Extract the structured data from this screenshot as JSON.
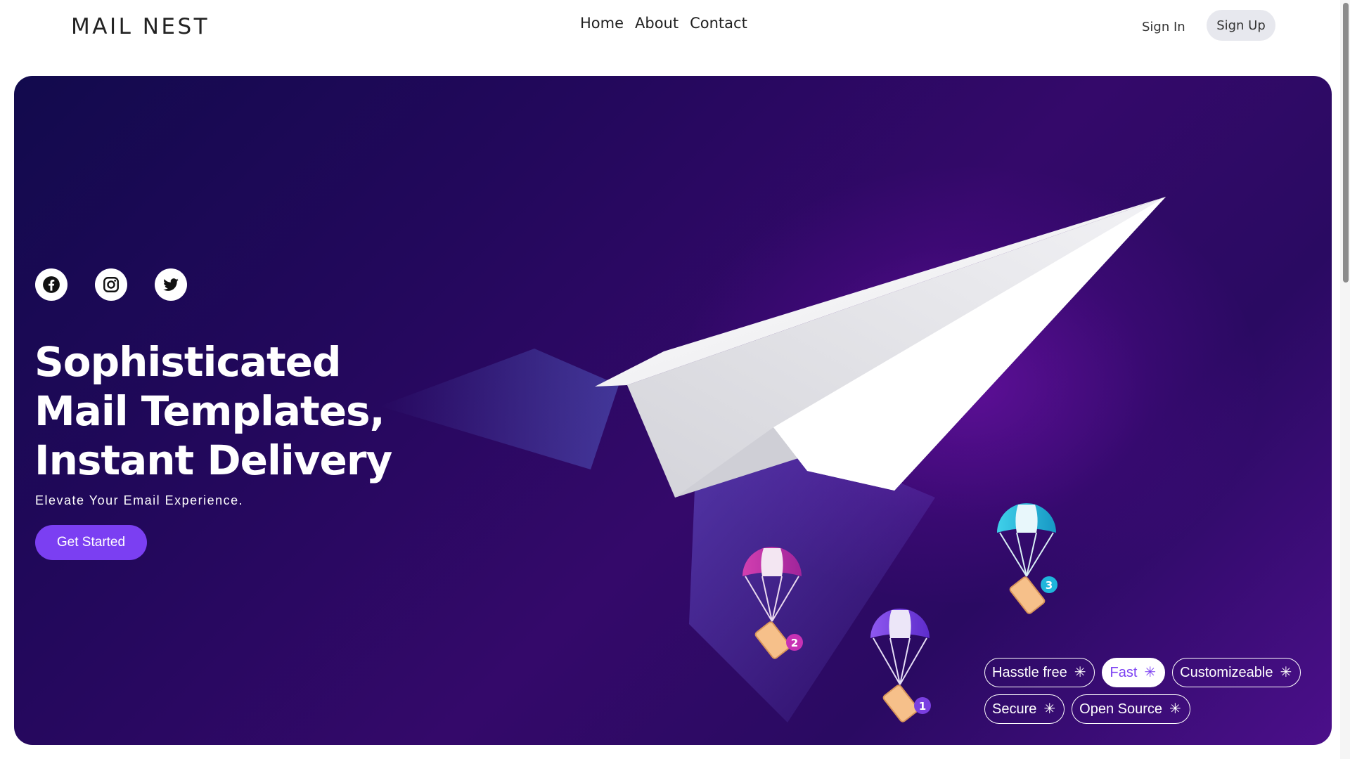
{
  "header": {
    "logo": "MAIL NEST",
    "nav": [
      "Home",
      "About",
      "Contact"
    ],
    "signin_label": "Sign In",
    "signup_label": "Sign Up"
  },
  "hero": {
    "socials": [
      {
        "name": "facebook-icon"
      },
      {
        "name": "instagram-icon"
      },
      {
        "name": "twitter-icon"
      }
    ],
    "headline": [
      "Sophisticated",
      "Mail Templates,",
      "Instant Delivery"
    ],
    "subtitle": "Elevate Your Email Experience.",
    "cta_label": "Get Started",
    "badges": [
      "1",
      "2",
      "3"
    ],
    "tags_row1": [
      {
        "label": "Hasstle free",
        "active": false
      },
      {
        "label": "Fast",
        "active": true
      },
      {
        "label": "Customizeable",
        "active": false
      }
    ],
    "tags_row2": [
      {
        "label": "Secure",
        "active": false
      },
      {
        "label": "Open Source",
        "active": false
      }
    ],
    "star_glyph": "✳"
  },
  "colors": {
    "accent": "#7b3ff2",
    "hero_dark": "#120a4d",
    "hero_purple": "#4b0f8a"
  }
}
